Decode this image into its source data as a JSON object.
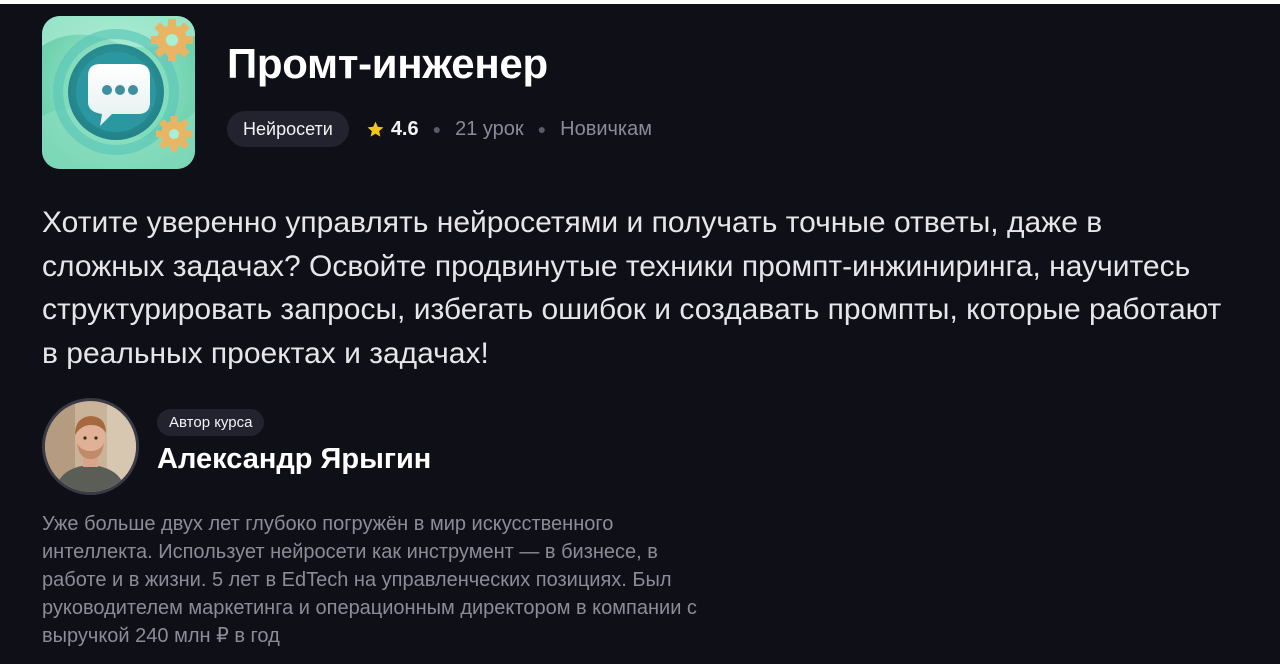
{
  "course": {
    "title": "Промт-инженер",
    "category": "Нейросети",
    "rating": "4.6",
    "lessons": "21 урок",
    "level": "Новичкам",
    "description": "Хотите уверенно управлять нейросетями и получать точные ответы, даже в сложных задачах? Освойте продвинутые техники промпт-инжиниринга, научитесь структурировать запросы, избегать ошибок и создавать промпты, которые работают в реальных проектах и задачах!"
  },
  "author": {
    "badge": "Автор курса",
    "name": "Александр Ярыгин",
    "bio": "Уже больше двух лет глубоко погружён в мир искусственного интеллекта. Использует нейросети как инструмент — в бизнесе, в работе и в жизни. 5 лет в EdTech на управленческих позициях. Был руководителем маркетинга и операционным директором в компании с выручкой 240 млн ₽ в год"
  },
  "icons": {
    "course": "chat-bubble-gears-icon",
    "rating": "star-icon",
    "author": "avatar"
  },
  "colors": {
    "background": "#0f0f17",
    "star": "#f5c518",
    "icon_bg": "#7fd8b9"
  }
}
